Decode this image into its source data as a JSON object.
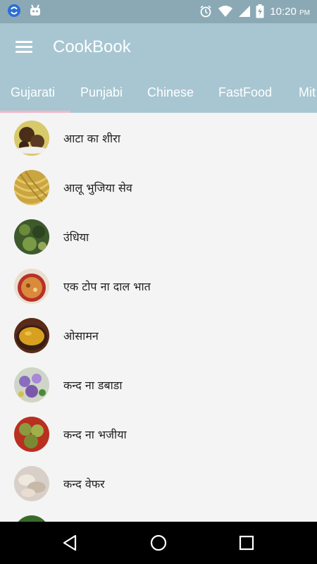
{
  "status_bar": {
    "time": "10:20",
    "ampm": "PM",
    "icons": [
      "sync-icon",
      "android-debug-icon",
      "alarm-icon",
      "wifi-icon",
      "signal-icon",
      "battery-charging-icon"
    ]
  },
  "app_bar": {
    "title": "CookBook",
    "menu_icon": "hamburger-menu-icon"
  },
  "tabs": [
    {
      "label": "Gujarati",
      "selected": true
    },
    {
      "label": "Punjabi",
      "selected": false
    },
    {
      "label": "Chinese",
      "selected": false
    },
    {
      "label": "FastFood",
      "selected": false
    },
    {
      "label": "Mit",
      "selected": false
    }
  ],
  "recipes": [
    {
      "name": "आटा का शीरा"
    },
    {
      "name": "आलू भुजिया सेव"
    },
    {
      "name": "उंधिया"
    },
    {
      "name": "एक टोप ना दाल भात"
    },
    {
      "name": "ओसामन"
    },
    {
      "name": "कन्द ना डबाडा"
    },
    {
      "name": "कन्द ना भजीया"
    },
    {
      "name": "कन्द वेफर"
    }
  ],
  "nav_bar": {
    "icons": [
      "back-icon",
      "home-icon",
      "recents-icon"
    ]
  },
  "colors": {
    "status_bar": "#8aa9b5",
    "app_bar": "#a7c6d2",
    "tab_indicator": "#f2b8c6",
    "list_background": "#f4f4f4"
  }
}
